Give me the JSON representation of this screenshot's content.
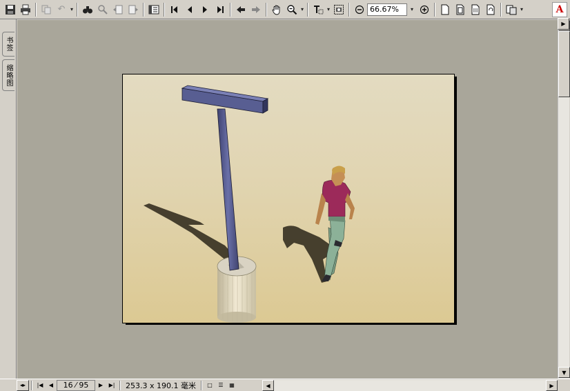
{
  "toolbar": {
    "zoom_value": "66.67%",
    "buttons": [
      {
        "name": "save-icon"
      },
      {
        "name": "print-icon"
      },
      {
        "name": "copy-icon"
      },
      {
        "name": "undo-icon"
      },
      {
        "name": "find-icon"
      },
      {
        "name": "search-icon"
      },
      {
        "name": "prev-view-icon"
      },
      {
        "name": "next-view-icon"
      },
      {
        "name": "navigation-pane-icon"
      },
      {
        "name": "first-page-icon"
      },
      {
        "name": "previous-page-icon"
      },
      {
        "name": "next-page-icon"
      },
      {
        "name": "last-page-icon"
      },
      {
        "name": "go-back-icon"
      },
      {
        "name": "go-forward-icon"
      },
      {
        "name": "hand-tool-icon"
      },
      {
        "name": "zoom-tool-icon"
      },
      {
        "name": "text-select-icon"
      },
      {
        "name": "snapshot-icon"
      },
      {
        "name": "zoom-out-icon"
      },
      {
        "name": "zoom-in-icon"
      },
      {
        "name": "actual-size-icon"
      },
      {
        "name": "fit-page-icon"
      },
      {
        "name": "fit-width-icon"
      },
      {
        "name": "rotate-icon"
      },
      {
        "name": "export-icon"
      }
    ],
    "logo_letter": "A"
  },
  "nav_tabs": [
    {
      "label": "书签"
    },
    {
      "label": "缩略图"
    }
  ],
  "status": {
    "current_page": "16",
    "total_pages": "95",
    "page_display": "16 ⁄ 95",
    "page_size": "253.3 x 190.1 毫米"
  },
  "colors": {
    "app_chrome": "#d4d0c8",
    "doc_background": "#a9a69a",
    "page_paper": "#e0d4b0",
    "signpost": "#5a5e8c",
    "shirt": "#9c2a5a",
    "pants": "#7c9e84"
  },
  "page_content": {
    "type": "3d-rendered illustration",
    "objects": [
      "signpost",
      "walking-person",
      "base-cylinder",
      "shadows"
    ]
  }
}
